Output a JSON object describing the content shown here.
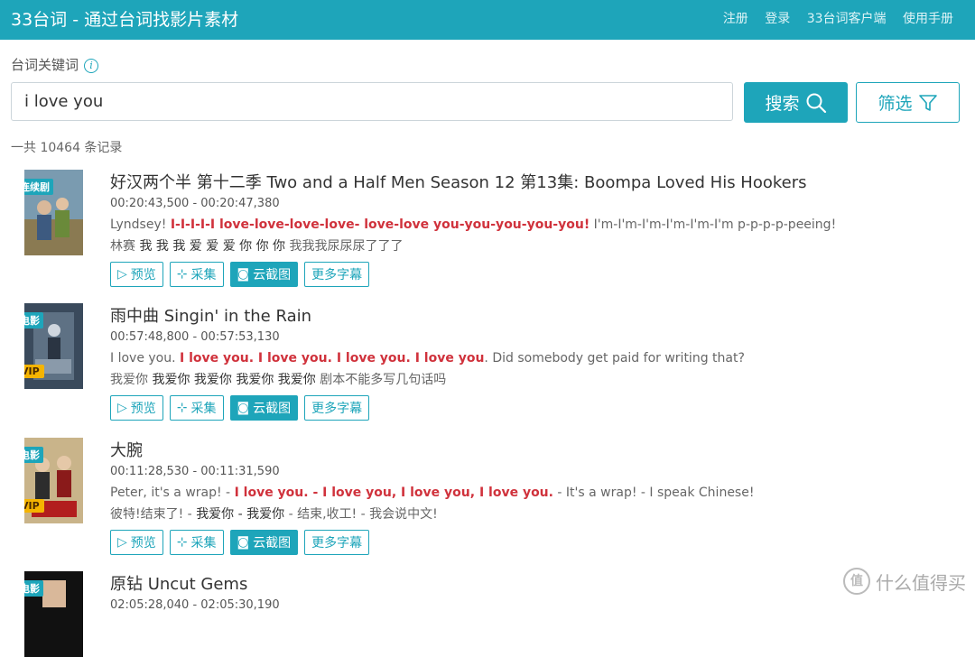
{
  "header": {
    "title": "33台词 - 通过台词找影片素材",
    "nav": [
      "注册",
      "登录",
      "33台词客户端",
      "使用手册"
    ]
  },
  "search": {
    "label": "台词关键词",
    "value": "i love you",
    "search_button": "搜索",
    "filter_button": "筛选"
  },
  "count_text": "一共 10464 条记录",
  "actions": [
    "预览",
    "采集",
    "云截图",
    "更多字幕"
  ],
  "results": [
    {
      "badge": "连续剧",
      "vip": "",
      "title": "好汉两个半 第十二季 Two and a Half Men Season 12 第13集: Boompa Loved His Hookers",
      "time": "00:20:43,500 - 00:20:47,380",
      "en_pre": "Lyndsey!  ",
      "en_hl": "I-I-I-I-I love-love-love-love- love-love you-you-you-you-you!",
      "en_post": " I'm-I'm-I'm-I'm-I'm-I'm p-p-p-p-peeing!",
      "zh_pre": "林赛  ",
      "zh_hl": "我 我 我 爱 爱 爱 你 你 你",
      "zh_post": " 我我我尿尿尿了了了",
      "poster_text": "TWO EN"
    },
    {
      "badge": "电影",
      "vip": "VIP",
      "title": "雨中曲 Singin' in the Rain",
      "time": "00:57:48,800 - 00:57:53,130",
      "en_pre": "I love you.  ",
      "en_hl": "I love you. I love you. I love you. I love you",
      "en_post": ". Did somebody get paid for writing that?",
      "zh_pre": "我爱你  ",
      "zh_hl": "我爱你 我爱你 我爱你 我爱你",
      "zh_post": " 剧本不能多写几句话吗",
      "poster_text": "SINGIN' IN THE RAIN"
    },
    {
      "badge": "电影",
      "vip": "VIP",
      "title": "大腕",
      "time": "00:11:28,530 - 00:11:31,590",
      "en_pre": "Peter, it's a wrap!  - ",
      "en_hl": "I love you. - I love you, I love you, I love you.",
      "en_post": " - It's a wrap! - I speak Chinese!",
      "zh_pre": "彼特!结束了!  - ",
      "zh_hl": "我爱你 - 我爱你",
      "zh_post": " - 结束,收工! - 我会说中文!",
      "poster_text": "大腕"
    },
    {
      "badge": "电影",
      "vip": "",
      "title": "原钻 Uncut Gems",
      "time": "02:05:28,040 - 02:05:30,190",
      "poster_text": "Adam Sandler Uncut Gems"
    }
  ],
  "watermark": "什么值得买",
  "watermark_mark": "值"
}
